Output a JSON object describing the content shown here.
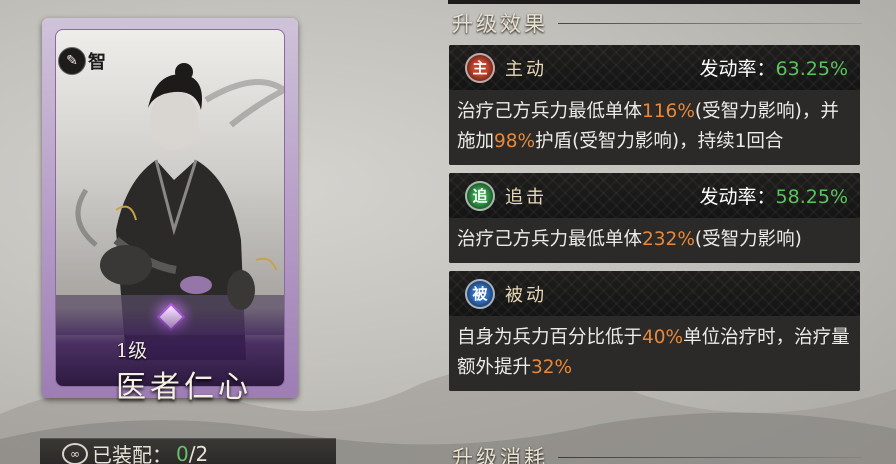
{
  "card": {
    "type_icon": "book-icon",
    "type_glyph": "✎",
    "type_label": "智",
    "level": "1级",
    "name": "医者仁心"
  },
  "equip": {
    "label": "已装配：",
    "count": "0",
    "total": "/2"
  },
  "sections": {
    "upgrade_effect": "升级效果",
    "upgrade_cost": "升级消耗"
  },
  "rate_label": "发动率：",
  "skills": [
    {
      "icon_char": "主",
      "icon_color": "#c8412a",
      "type": "主动",
      "rate": "63.25%",
      "desc": [
        {
          "t": "治疗己方兵力最低单体"
        },
        {
          "t": "116%",
          "hl": true
        },
        {
          "t": "(受智力影响)，并施加"
        },
        {
          "t": "98%",
          "hl": true
        },
        {
          "t": "护盾(受智力影响)，持续1回合"
        }
      ]
    },
    {
      "icon_char": "追",
      "icon_color": "#2f9a47",
      "type": "追击",
      "rate": "58.25%",
      "desc": [
        {
          "t": "治疗己方兵力最低单体"
        },
        {
          "t": "232%",
          "hl": true
        },
        {
          "t": "(受智力影响)"
        }
      ]
    },
    {
      "icon_char": "被",
      "icon_color": "#2d6fc4",
      "type": "被动",
      "rate": "",
      "desc": [
        {
          "t": "自身为兵力百分比低于"
        },
        {
          "t": "40%",
          "hl": true
        },
        {
          "t": "单位治疗时，治疗量额外提升"
        },
        {
          "t": "32%",
          "hl": true
        }
      ]
    }
  ],
  "colors": {
    "highlight": "#e8883a",
    "rate_value": "#5cc25c",
    "card_frame": "#a98bc0"
  }
}
